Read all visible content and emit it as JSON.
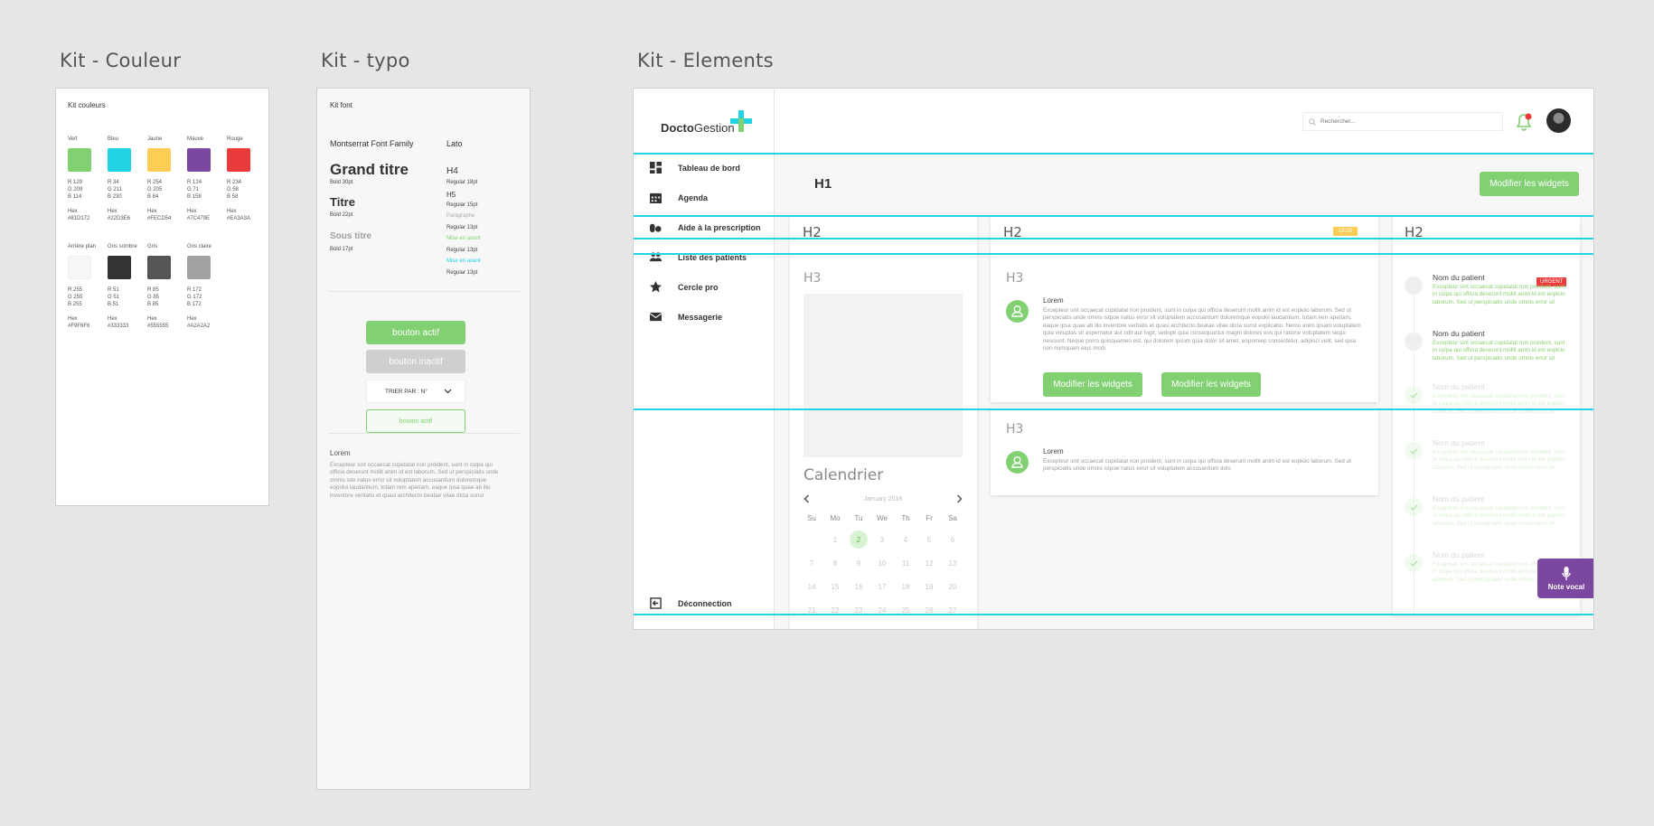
{
  "titles": {
    "couleur": "Kit - Couleur",
    "typo": "Kit - typo",
    "elements": "Kit - Elements"
  },
  "couleur": {
    "heading": "Kit couleurs",
    "row1": [
      {
        "name": "Vert",
        "color": "#81D172",
        "r": "R 129",
        "g": "G 209",
        "b": "B 114",
        "hl": "Hex",
        "hex": "#81D172"
      },
      {
        "name": "Bleu",
        "color": "#22D3E6",
        "r": "R 34",
        "g": "G 211",
        "b": "B 230",
        "hl": "Hex",
        "hex": "#22D3E6"
      },
      {
        "name": "Jaune",
        "color": "#FECD54",
        "r": "R 254",
        "g": "G 205",
        "b": "B 84",
        "hl": "Hex",
        "hex": "#FECD54"
      },
      {
        "name": "Mauve",
        "color": "#7C479E",
        "r": "R 124",
        "g": "G 71",
        "b": "B 158",
        "hl": "Hex",
        "hex": "#7C479E"
      },
      {
        "name": "Rouge",
        "color": "#EA3A3A",
        "r": "R 234",
        "g": "G 58",
        "b": "B 58",
        "hl": "Hex",
        "hex": "#EA3A3A"
      }
    ],
    "row2": [
      {
        "name": "Arrière plan",
        "color": "#F9F6F6",
        "r": "R 255",
        "g": "G 255",
        "b": "B 255",
        "hl": "Hex",
        "hex": "#F9F6F6"
      },
      {
        "name": "Gris sombre",
        "color": "#333333",
        "r": "R 51",
        "g": "G 51",
        "b": "B 51",
        "hl": "Hex",
        "hex": "#333333"
      },
      {
        "name": "Gris",
        "color": "#555555",
        "r": "R 85",
        "g": "G 85",
        "b": "B 85",
        "hl": "Hex",
        "hex": "#555555"
      },
      {
        "name": "Gris claire",
        "color": "#A2A2A2",
        "r": "R 172",
        "g": "G 172",
        "b": "B 172",
        "hl": "Hex",
        "hex": "#A2A2A2"
      }
    ]
  },
  "typo": {
    "heading": "Kit font",
    "family1": "Montserrat Font Family",
    "family2": "Lato",
    "grand": "Grand titre",
    "grand_sub": "Bold 30pt",
    "titre": "Titre",
    "titre_sub": "Bold 22pt",
    "sous": "Sous titre",
    "sous_sub": "Bold 17pt",
    "h4": "H4",
    "h4_sub": "Regular 18pt",
    "h5": "H5",
    "h5_sub": "Regular 15pt",
    "para": "Paragraphe",
    "para_sub": "Regular 13pt",
    "mise1": "Mise en avant",
    "mise1_sub": "Regular 13pt",
    "mise2": "Mise en avant",
    "mise2_sub": "Regular 13pt",
    "btn_actif": "bouton actif",
    "btn_inactif": "bouton inactif",
    "trier": "TRIER PAR : N°",
    "btn_outline": "bouton actif",
    "lorem_title": "Lorem",
    "lorem_text": "Excepteur sint occaecat cupidatat non proident, sunt in culpa qui officia deserunt mollit anim id est laborum. Sed ut perspiciatis unde omnis iste natus error sit voluptatem accusantium doloremque eopolui laudantium, totam rem aperiam, eaque ipsa quae ab illo inventore veritatis et quasi architecto beatae vitae dicta sunst"
  },
  "app": {
    "logo_a": "Docto",
    "logo_b": "Gestion",
    "search_placeholder": "Rechercher...",
    "nav": [
      "Tableau de bord",
      "Agenda",
      "Aide à la prescription",
      "Liste des patients",
      "Cercle pro",
      "Messagerie"
    ],
    "logout": "Déconnection",
    "h1": "H1",
    "modify": "Modifier les widgets",
    "col1": {
      "h2": "H2",
      "h3": "H3",
      "cal_title": "Calendrier",
      "month": "January 2018",
      "days": [
        "Su",
        "Mo",
        "Tu",
        "We",
        "Th",
        "Fr",
        "Sa"
      ],
      "weeks": [
        [
          "",
          "1",
          "2",
          "3",
          "4",
          "5",
          "6"
        ],
        [
          "7",
          "8",
          "9",
          "10",
          "11",
          "12",
          "13"
        ],
        [
          "14",
          "15",
          "16",
          "17",
          "18",
          "19",
          "20"
        ],
        [
          "21",
          "22",
          "23",
          "24",
          "25",
          "26",
          "27"
        ]
      ]
    },
    "col2": {
      "h2": "H2",
      "badge": "15:25",
      "h3a": "H3",
      "lorem": "Lorem",
      "text_a": "Excepteur sint occaecat cupidatat non proident, sunt in culpa qui officia deserunt mollit anim id est eopkiio laborum. Sed ut perspiciatis unde omnis istpoe natus error sit voluptatem accusantium doloremque eopokii laudantium, totam rem aperiam, eaque ipsa quae ab illo inventore veritatis et quasi architecto beatae vitae dicta sunst explicabo. Nemo enim ipsam voluptatem quia voluptas sit aspernatur aut odit aut fugit, sedopk quia consequuntur magni dolores eos qui ratione voluptatem sequi nesciunt. Neque porro quisquameo est, qui dolorem ipsum quia dolor sit amet, eopomiep consectetur, adipisci velit, sed quia non numquam eius modi",
      "btn1": "Modifier les widgets",
      "btn2": "Modifier les widgets",
      "h3b": "H3",
      "lorem_b": "Lorem",
      "text_b": "Excepteur sint occaecat cupidatat non proident, sunt in culpa qui officia deserunt mollit anim id est eopkiio laborum. Sed ut perspiciatis unde omnis istpoe natus error sit voluptatem accusantium dolo"
    },
    "col3": {
      "h2": "H2",
      "urgent": "URGENT",
      "items": [
        {
          "name": "Nom du patient",
          "text": "Excepteur sint occaecat cupidatat non proident, sunt in culpa qui officia deserunt mollit anim id est eopkiio laborum. Sed ut perspiciatis unde omnis error sit"
        },
        {
          "name": "Nom du patient",
          "text": "Excepteur sint occaecat cupidatat non proident, sunt in culpa qui officia deserunt mollit anim id est eopkiio laborum. Sed ut perspiciatis unde omnis error sit"
        },
        {
          "name": "Nom du patient",
          "text": "Excepteur sint occaecat cupidatat non proident, sunt in culpa qui officia deserunt mollit anim id est eopkiio laborum. Sed ut perspiciatis unde omnis error sit"
        },
        {
          "name": "Nom du patient",
          "text": "Excepteur sint occaecat cupidatat non proident, sunt in culpa qui officia deserunt mollit anim id est eopkiio laborum. Sed ut perspiciatis unde omnis error sit"
        },
        {
          "name": "Nom du patient",
          "text": "Excepteur sint occaecat cupidatat non proident, sunt in culpa qui officia deserunt mollit anim id est eopkiio laborum. Sed ut perspiciatis unde omnis error sit"
        },
        {
          "name": "Nom du patient",
          "text": "Excepteur sint occaecat cupidatat non proident, sunt in culpa qui officia deserunt mollit anim id est eopkiio laborum. Sed ut perspiciatis unde omnis error sit"
        }
      ]
    },
    "note_vocal": "Note vocal"
  }
}
